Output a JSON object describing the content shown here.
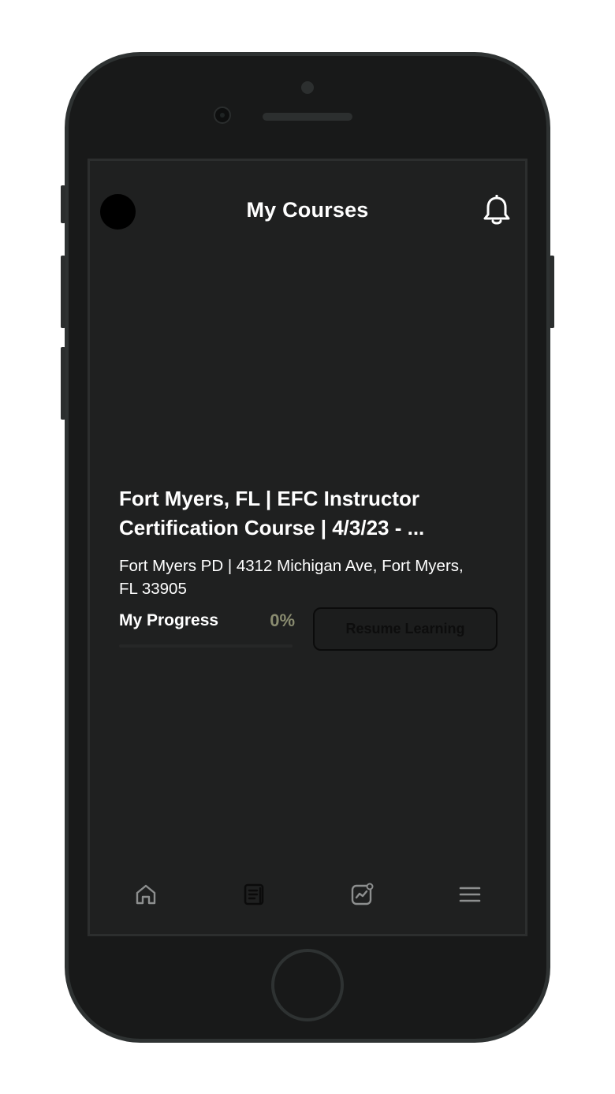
{
  "header": {
    "title": "My Courses"
  },
  "course": {
    "title_line1": "Fort Myers, FL | EFC Instructor",
    "title_line2": "Certification Course | 4/3/23 - ...",
    "location_line1": "Fort Myers PD | 4312 Michigan Ave, Fort Myers,",
    "location_line2": "FL 33905",
    "progress_label": "My Progress",
    "progress_value": "0%",
    "progress_fraction": 0,
    "resume_label": "Resume Learning"
  },
  "tabs": [
    {
      "icon": "home-icon"
    },
    {
      "icon": "courses-icon",
      "active": true
    },
    {
      "icon": "analytics-icon"
    },
    {
      "icon": "menu-icon"
    }
  ],
  "colors": {
    "screen_bg": "#1f2020",
    "text": "#ffffff",
    "accent": "#8a8c70",
    "tab_icon": "#8d8f8f",
    "tab_icon_active": "#0b0b0b"
  }
}
